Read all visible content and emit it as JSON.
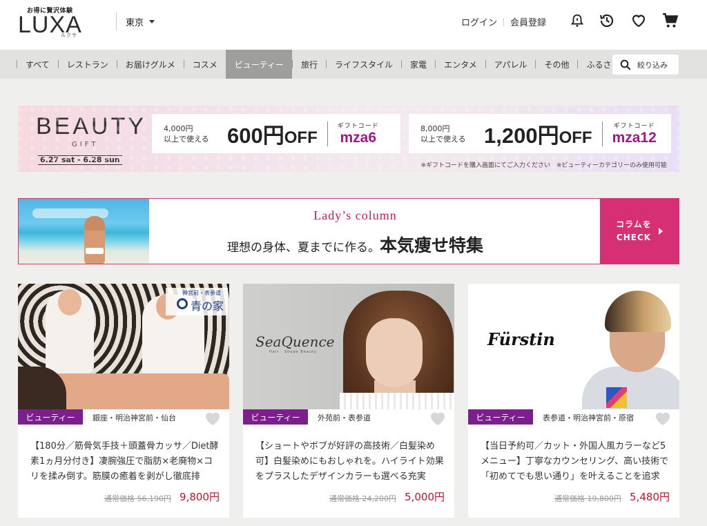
{
  "header": {
    "logo_tagline": "お得に贅沢体験",
    "logo_text": "LUXA",
    "logo_kana": "ルクサ",
    "location": "東京",
    "login": "ログイン",
    "register": "会員登録",
    "icons": [
      "bell-icon",
      "history-icon",
      "heart-icon",
      "cart-icon"
    ]
  },
  "nav": {
    "items": [
      "すべて",
      "レストラン",
      "お届けグルメ",
      "コスメ",
      "ビューティー",
      "旅行",
      "ライフスタイル",
      "家電",
      "エンタメ",
      "アパレル",
      "その他",
      "ふるさと納税"
    ],
    "active": "ビューティー",
    "search_label": "絞り込み"
  },
  "gift_banner": {
    "title": "BEAUTY",
    "subtitle": "GIFT",
    "dates": "6.27 sat - 6.28 sun",
    "coupons": [
      {
        "cond1": "4,000円",
        "cond2": "以上で使える",
        "amount": "600",
        "yen": "円",
        "off": "OFF",
        "code_label": "ギフトコード",
        "code": "mza6"
      },
      {
        "cond1": "8,000円",
        "cond2": "以上で使える",
        "amount": "1,200",
        "yen": "円",
        "off": "OFF",
        "code_label": "ギフトコード",
        "code": "mza12"
      }
    ],
    "note": "※ギフトコードを購入画面にてご入力ください　※ビューティーカテゴリーのみ使用可能"
  },
  "column_banner": {
    "title": "Lady’s column",
    "text_small": "理想の身体、夏までに作る。",
    "text_big": "本気痩せ特集",
    "cta_line1": "コラムを",
    "cta_line2": "CHECK"
  },
  "cards": [
    {
      "badge": "ビューティー",
      "area": "銀座・明治神宮前・仙台",
      "title": "【180分／筋骨気手技＋頭蓋骨カッサ／Diet酵素1ヵ月分付き】凄腕強圧で脂肪×老廃物×コリを揉み倒す。筋膜の癒着を剥がし徹底排",
      "old_price": "通常価格 56,190円",
      "price": "9,800円",
      "brand_small": "神宮前・表参道",
      "brand": "青の家"
    },
    {
      "badge": "ビューティー",
      "area": "外苑前・表参道",
      "title": "【ショートやボブが好評の高技術／白髪染め可】白髪染めにもおしゃれを。ハイライト効果をプラスしたデザインカラーも選べる充実",
      "old_price": "通常価格 24,200円",
      "price": "5,000円",
      "brand": "SeaQuence",
      "brand_sub": "Hair · Shape Beauty"
    },
    {
      "badge": "ビューティー",
      "area": "表参道・明治神宮前・原宿",
      "title": "【当日予約可／カット・外国人風カラーなど5メニュー】丁寧なカウンセリング、高い技術で「初めてでも思い通り」を叶えることを追求",
      "old_price": "通常価格 19,800円",
      "price": "5,480円",
      "brand": "Fürstin"
    }
  ],
  "colors": {
    "accent": "#d62f73",
    "badge": "#7b1f8c",
    "price": "#c8102e",
    "code": "#a0168a"
  }
}
